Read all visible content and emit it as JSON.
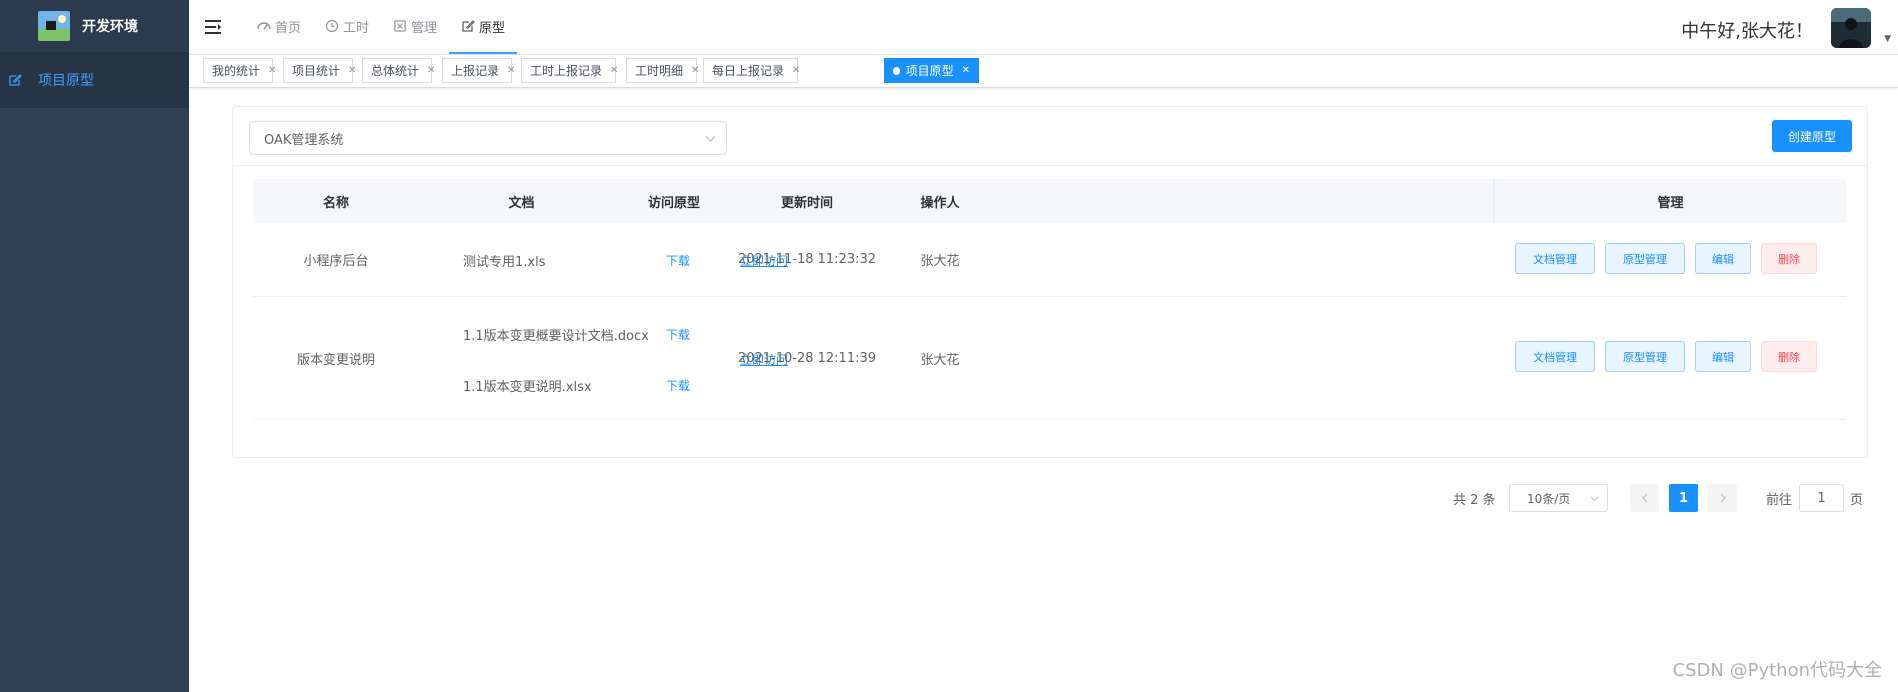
{
  "sidebar": {
    "brand_title": "开发环境",
    "menu": [
      {
        "label": "项目原型",
        "icon": "edit-icon",
        "active": true
      }
    ]
  },
  "header": {
    "nav": [
      {
        "label": "首页",
        "icon": "dashboard-icon"
      },
      {
        "label": "工时",
        "icon": "clock-icon"
      },
      {
        "label": "管理",
        "icon": "box-icon"
      },
      {
        "label": "原型",
        "icon": "edit-icon",
        "active": true
      }
    ],
    "greeting": "中午好,张大花！"
  },
  "tags": [
    {
      "label": "我的统计"
    },
    {
      "label": "项目统计"
    },
    {
      "label": "总体统计"
    },
    {
      "label": "上报记录"
    },
    {
      "label": "工时上报记录"
    },
    {
      "label": "工时明细"
    },
    {
      "label": "每日上报记录"
    },
    {
      "label": "项目原型",
      "active": true
    }
  ],
  "toolbar": {
    "project_select": "OAK管理系统",
    "create_label": "创建原型"
  },
  "table": {
    "columns": [
      "名称",
      "文档",
      "访问原型",
      "更新时间",
      "操作人",
      "管理"
    ],
    "rows": [
      {
        "name": "小程序后台",
        "docs": [
          {
            "file": "测试专用1.xls",
            "download": "下载"
          }
        ],
        "visit": "立即访问",
        "updated": "2021-11-18 11:23:32",
        "operator": "张大花",
        "actions": [
          "文档管理",
          "原型管理",
          "编辑",
          "删除"
        ]
      },
      {
        "name": "版本变更说明",
        "docs": [
          {
            "file": "1.1版本变更概要设计文档.docx",
            "download": "下载"
          },
          {
            "file": "1.1版本变更说明.xlsx",
            "download": "下载"
          }
        ],
        "visit": "立即访问",
        "updated": "2021-10-28 12:11:39",
        "operator": "张大花",
        "actions": [
          "文档管理",
          "原型管理",
          "编辑",
          "删除"
        ]
      }
    ]
  },
  "pagination": {
    "total": "共 2 条",
    "page_size": "10条/页",
    "current": "1",
    "goto_label": "前往",
    "goto_value": "1",
    "page_label": "页"
  },
  "watermark": "CSDN @Python代码大全",
  "colors": {
    "primary": "#1890ff",
    "sidebar": "#304156",
    "danger": "#ff4949"
  }
}
